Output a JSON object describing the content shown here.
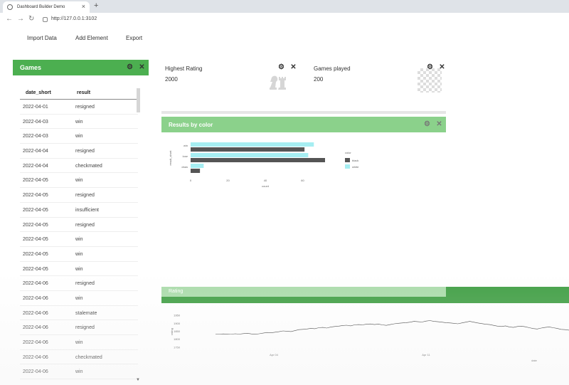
{
  "browser": {
    "tab_title": "Dashboard Builder Demo",
    "new_tab": "+",
    "url": "http://127.0.0.1:3102"
  },
  "menu": {
    "import": "Import Data",
    "add": "Add Element",
    "export": "Export"
  },
  "games_panel": {
    "title": "Games",
    "columns": [
      "date_short",
      "result"
    ],
    "rows": [
      [
        "2022-04-01",
        "resigned"
      ],
      [
        "2022-04-03",
        "win"
      ],
      [
        "2022-04-03",
        "win"
      ],
      [
        "2022-04-04",
        "resigned"
      ],
      [
        "2022-04-04",
        "checkmated"
      ],
      [
        "2022-04-05",
        "win"
      ],
      [
        "2022-04-05",
        "resigned"
      ],
      [
        "2022-04-05",
        "insufficient"
      ],
      [
        "2022-04-05",
        "resigned"
      ],
      [
        "2022-04-05",
        "win"
      ],
      [
        "2022-04-05",
        "win"
      ],
      [
        "2022-04-05",
        "win"
      ],
      [
        "2022-04-06",
        "resigned"
      ],
      [
        "2022-04-06",
        "win"
      ],
      [
        "2022-04-06",
        "stalemate"
      ],
      [
        "2022-04-06",
        "resigned"
      ],
      [
        "2022-04-06",
        "win"
      ],
      [
        "2022-04-06",
        "checkmated"
      ],
      [
        "2022-04-06",
        "win"
      ]
    ]
  },
  "kpis": {
    "highest_rating_label": "Highest Rating",
    "highest_rating_value": "2000",
    "games_played_label": "Games played",
    "games_played_value": "200"
  },
  "results_panel": {
    "title": "Results by color"
  },
  "rating_panel": {
    "title": "Rating"
  },
  "icons": {
    "settings": "⚙",
    "close": "✕"
  },
  "colors": {
    "header_green": "#4caf50",
    "header_light_green": "#8bd18b",
    "black_series": "#555555",
    "white_series": "#a6eef2",
    "line": "#333333"
  },
  "chart_data": [
    {
      "type": "bar",
      "orientation": "horizontal",
      "title": "",
      "xlabel": "count",
      "ylabel": "result_short",
      "categories": [
        "win",
        "lose",
        "draw"
      ],
      "series": [
        {
          "name": "black",
          "values": [
            61,
            72,
            5
          ]
        },
        {
          "name": "white",
          "values": [
            66,
            63,
            7
          ]
        }
      ],
      "xlim": [
        0,
        80
      ],
      "x_ticks": [
        "0",
        "20",
        "40",
        "60"
      ],
      "legend_title": "color",
      "legend_position": "right"
    },
    {
      "type": "line",
      "title": "",
      "xlabel": "date",
      "ylabel": "rating",
      "y_ticks": [
        "1950",
        "1900",
        "1850",
        "1800",
        "1750"
      ],
      "x_ticks": [
        "Apr 04",
        "Apr 11"
      ],
      "ylim": [
        1720,
        1980
      ],
      "series": [
        {
          "values": [
            1830,
            1830,
            1831,
            1829,
            1830,
            1832,
            1830,
            1833,
            1835,
            1831,
            1829,
            1832,
            1836,
            1840,
            1838,
            1842,
            1845,
            1850,
            1848,
            1846,
            1852,
            1858,
            1860,
            1862,
            1866,
            1864,
            1870,
            1872,
            1868,
            1874,
            1878,
            1880,
            1884,
            1886,
            1882,
            1888,
            1890,
            1888,
            1892,
            1894,
            1890,
            1893,
            1888,
            1885,
            1890,
            1895,
            1898,
            1900,
            1902,
            1905,
            1910,
            1908,
            1906,
            1912,
            1915,
            1910,
            1908,
            1905,
            1902,
            1900,
            1898,
            1895,
            1900,
            1905,
            1910,
            1905,
            1900,
            1896,
            1892,
            1890,
            1885,
            1880,
            1878,
            1882,
            1875,
            1872,
            1878,
            1880,
            1876,
            1870,
            1865,
            1862,
            1868,
            1872,
            1875,
            1870,
            1866,
            1860,
            1858,
            1855
          ]
        }
      ]
    }
  ]
}
